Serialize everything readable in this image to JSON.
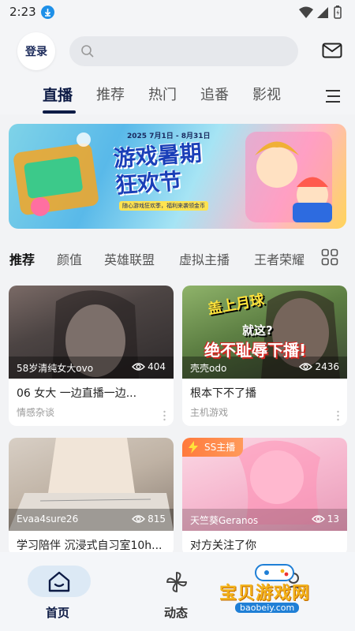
{
  "status_bar": {
    "time": "2:23"
  },
  "header": {
    "login_label": "登录",
    "search": {
      "placeholder": ""
    },
    "tabs": [
      {
        "label": "直播",
        "active": true
      },
      {
        "label": "推荐",
        "active": false
      },
      {
        "label": "热门",
        "active": false
      },
      {
        "label": "追番",
        "active": false
      },
      {
        "label": "影视",
        "active": false
      }
    ]
  },
  "banner": {
    "date": "2025 7月1日 - 8月31日",
    "title_line1": "游戏暑期",
    "title_line2": "狂欢节",
    "subtitle": "随心游戏狂欢季，福利来袭领金币"
  },
  "categories": [
    {
      "label": "推荐",
      "active": true
    },
    {
      "label": "颜值",
      "active": false
    },
    {
      "label": "英雄联盟",
      "active": false
    },
    {
      "label": "虚拟主播",
      "active": false
    },
    {
      "label": "王者荣耀",
      "active": false
    }
  ],
  "cards": [
    {
      "name": "58岁清纯女大ovo",
      "views": "404",
      "title": "06 女大 一边直播一边...",
      "category": "情感杂谈",
      "badge": ""
    },
    {
      "name": "壳壳odo",
      "views": "2436",
      "title": "根本下不了播",
      "category": "主机游戏",
      "badge": "",
      "overlay_line1": "盖上月球",
      "overlay_line2": "就这?",
      "overlay_line3": "绝不耻辱下播!"
    },
    {
      "name": "Evaa4sure26",
      "views": "815",
      "title": "学习陪伴 沉浸式自习室10h...",
      "category": "",
      "badge": ""
    },
    {
      "name": "天竺葵Geranos",
      "views": "13",
      "title": "对方关注了你",
      "category": "",
      "badge": "SS主播"
    }
  ],
  "bottom_nav": [
    {
      "label": "首页",
      "active": true
    },
    {
      "label": "动态",
      "active": false
    }
  ],
  "watermark": {
    "text": "宝贝游戏网",
    "url": "baobeiy.com"
  },
  "colors": {
    "accent": "#0d1b45",
    "badge": "#ff7a3d",
    "watermark": "#f3b21a"
  }
}
